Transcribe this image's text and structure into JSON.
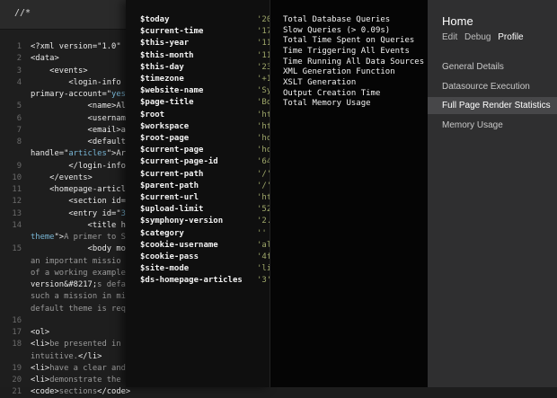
{
  "editor": {
    "crumb": "//*",
    "lines": [
      {
        "n": "1",
        "segs": [
          {
            "t": "<?xml version=\"1.0\" ",
            "c": "white"
          }
        ]
      },
      {
        "n": "2",
        "segs": [
          {
            "t": "<data>",
            "c": "white"
          }
        ]
      },
      {
        "n": "3",
        "segs": [
          {
            "t": "    <events>",
            "c": "white"
          }
        ]
      },
      {
        "n": "4",
        "segs": [
          {
            "t": "        <login-info ",
            "c": "white"
          }
        ]
      },
      {
        "n": "",
        "segs": [
          {
            "t": "primary-account=\"",
            "c": "white"
          },
          {
            "t": "yes",
            "c": "str"
          }
        ]
      },
      {
        "n": "5",
        "segs": [
          {
            "t": "            <name>Al",
            "c": "white"
          }
        ]
      },
      {
        "n": "6",
        "segs": [
          {
            "t": "            <usernam",
            "c": "white"
          }
        ]
      },
      {
        "n": "7",
        "segs": [
          {
            "t": "            <email>a",
            "c": "white"
          }
        ]
      },
      {
        "n": "8",
        "segs": [
          {
            "t": "            <default",
            "c": "white"
          }
        ]
      },
      {
        "n": "",
        "segs": [
          {
            "t": "handle=\"",
            "c": "white"
          },
          {
            "t": "articles",
            "c": "str"
          },
          {
            "t": "\">Ar",
            "c": "white"
          }
        ]
      },
      {
        "n": "9",
        "segs": [
          {
            "t": "        </login-info",
            "c": "white"
          }
        ]
      },
      {
        "n": "10",
        "segs": [
          {
            "t": "    </events>",
            "c": "white"
          }
        ]
      },
      {
        "n": "11",
        "segs": [
          {
            "t": "    <homepage-articl",
            "c": "white"
          }
        ]
      },
      {
        "n": "12",
        "segs": [
          {
            "t": "        <section id=",
            "c": "white"
          }
        ]
      },
      {
        "n": "13",
        "segs": [
          {
            "t": "        <entry id=\"",
            "c": "white"
          },
          {
            "t": "3",
            "c": "str"
          }
        ]
      },
      {
        "n": "14",
        "segs": [
          {
            "t": "            <title h",
            "c": "white"
          }
        ]
      },
      {
        "n": "",
        "segs": [
          {
            "t": "theme",
            "c": "str"
          },
          {
            "t": "\">",
            "c": "white"
          },
          {
            "t": "A primer to S",
            "c": "gray"
          }
        ]
      },
      {
        "n": "15",
        "segs": [
          {
            "t": "            <body mo",
            "c": "white"
          }
        ]
      },
      {
        "n": "",
        "segs": [
          {
            "t": "an important missio",
            "c": "gray"
          }
        ]
      },
      {
        "n": "",
        "segs": [
          {
            "t": "of a working example",
            "c": "gray"
          }
        ]
      },
      {
        "n": "",
        "segs": [
          {
            "t": "version&#8217;",
            "c": "white"
          },
          {
            "t": "s defa",
            "c": "gray"
          }
        ]
      },
      {
        "n": "",
        "segs": [
          {
            "t": "such a mission in mi",
            "c": "gray"
          }
        ]
      },
      {
        "n": "",
        "segs": [
          {
            "t": "default theme is req",
            "c": "gray"
          }
        ]
      },
      {
        "n": "16",
        "segs": [
          {
            "t": "",
            "c": "white"
          }
        ]
      },
      {
        "n": "17",
        "segs": [
          {
            "t": "<ol>",
            "c": "white"
          }
        ]
      },
      {
        "n": "18",
        "segs": [
          {
            "t": "<li>",
            "c": "white"
          },
          {
            "t": "be presented in ",
            "c": "gray"
          }
        ]
      },
      {
        "n": "",
        "segs": [
          {
            "t": "intuitive.",
            "c": "gray"
          },
          {
            "t": "</li>",
            "c": "white"
          }
        ]
      },
      {
        "n": "19",
        "segs": [
          {
            "t": "<li>",
            "c": "white"
          },
          {
            "t": "have a clear and",
            "c": "gray"
          }
        ]
      },
      {
        "n": "20",
        "segs": [
          {
            "t": "<li>",
            "c": "white"
          },
          {
            "t": "demonstrate the ",
            "c": "gray"
          }
        ]
      },
      {
        "n": "21",
        "segs": [
          {
            "t": "<code>",
            "c": "white"
          },
          {
            "t": "sections",
            "c": "gray"
          },
          {
            "t": "</code>",
            "c": "white"
          }
        ]
      }
    ]
  },
  "params": {
    "names": [
      "$today",
      "$current-time",
      "$this-year",
      "$this-month",
      "$this-day",
      "$timezone",
      "$website-name",
      "$page-title",
      "$root",
      "$workspace",
      "$root-page",
      "$current-page",
      "$current-page-id",
      "$current-path",
      "$parent-path",
      "$current-url",
      "$upload-limit",
      "$symphony-version",
      "$category",
      "$cookie-username",
      "$cookie-pass",
      "$site-mode",
      "$ds-homepage-articles"
    ],
    "values": [
      "'20",
      "'17",
      "'11",
      "'11",
      "'23",
      "'+1",
      "'Sy",
      "'Bo",
      "'ht",
      "'ht",
      "'ho",
      "'ho",
      "'64",
      "'/'",
      "'/'",
      "'ht",
      "'52",
      "'2.",
      "''",
      "'al",
      "'4f",
      "'li",
      "'3'"
    ]
  },
  "stats": {
    "items": [
      "Total Database Queries",
      "Slow Queries (> 0.09s)",
      "Total Time Spent on Queries",
      "Time Triggering All Events",
      "Time Running All Data Sources",
      "XML Generation Function",
      "XSLT Generation",
      "Output Creation Time",
      "Total Memory Usage"
    ]
  },
  "nav": {
    "title": "Home",
    "tabs": [
      {
        "label": "Edit",
        "active": false
      },
      {
        "label": "Debug",
        "active": false
      },
      {
        "label": "Profile",
        "active": true
      }
    ],
    "items": [
      {
        "label": "General Details",
        "active": false
      },
      {
        "label": "Datasource Execution",
        "active": false
      },
      {
        "label": "Full Page Render Statistics",
        "active": true
      },
      {
        "label": "Memory Usage",
        "active": false
      }
    ]
  },
  "colors": {
    "string": "#79b7d6",
    "nav_active_bg": "#474749",
    "param_value": "#9fa86a"
  }
}
